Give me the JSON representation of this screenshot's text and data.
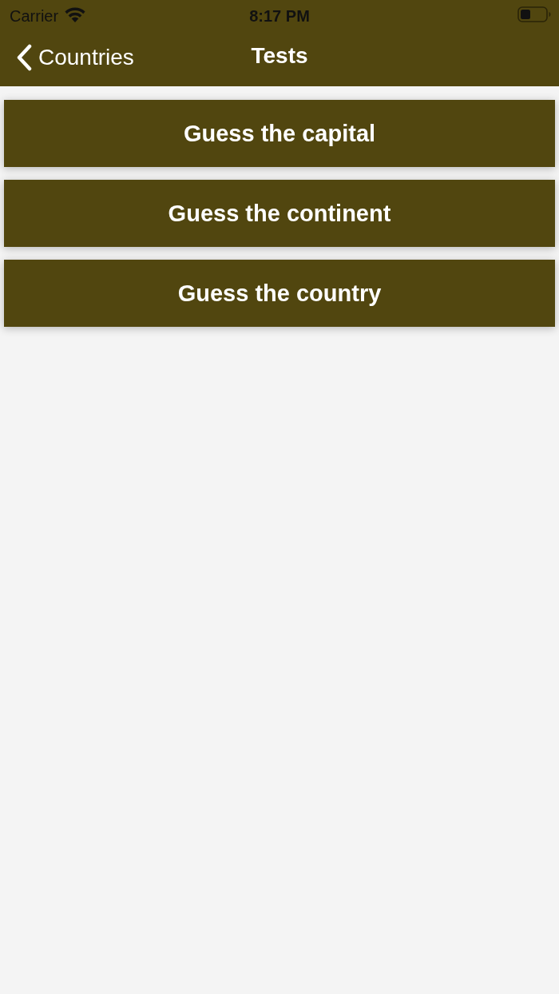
{
  "status_bar": {
    "carrier": "Carrier",
    "time": "8:17 PM"
  },
  "nav_bar": {
    "back_label": "Countries",
    "title": "Tests"
  },
  "tests": [
    {
      "label": "Guess the capital"
    },
    {
      "label": "Guess the continent"
    },
    {
      "label": "Guess the country"
    }
  ]
}
